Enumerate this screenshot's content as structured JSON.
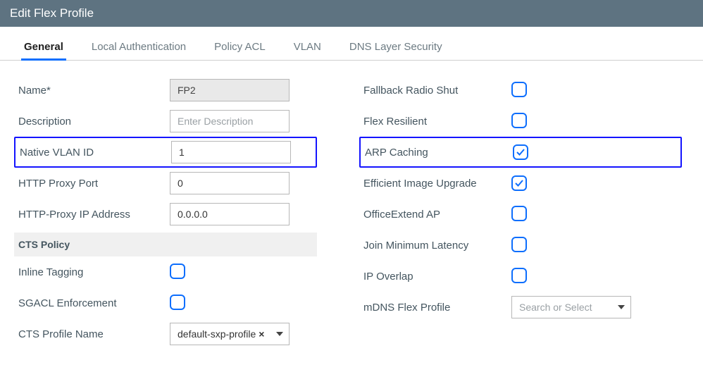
{
  "title": "Edit Flex Profile",
  "tabs": [
    {
      "label": "General",
      "active": true
    },
    {
      "label": "Local Authentication",
      "active": false
    },
    {
      "label": "Policy ACL",
      "active": false
    },
    {
      "label": "VLAN",
      "active": false
    },
    {
      "label": "DNS Layer Security",
      "active": false
    }
  ],
  "left": {
    "name_label": "Name*",
    "name_value": "FP2",
    "description_label": "Description",
    "description_placeholder": "Enter Description",
    "native_vlan_label": "Native VLAN ID",
    "native_vlan_value": "1",
    "http_proxy_port_label": "HTTP Proxy Port",
    "http_proxy_port_value": "0",
    "http_proxy_ip_label": "HTTP-Proxy IP Address",
    "http_proxy_ip_value": "0.0.0.0",
    "cts_header": "CTS Policy",
    "inline_tagging_label": "Inline Tagging",
    "sgacl_label": "SGACL Enforcement",
    "cts_profile_label": "CTS Profile Name",
    "cts_profile_value": "default-sxp-profile"
  },
  "right": {
    "fallback_label": "Fallback Radio Shut",
    "flex_resilient_label": "Flex Resilient",
    "arp_caching_label": "ARP Caching",
    "efficient_upgrade_label": "Efficient Image Upgrade",
    "officeextend_label": "OfficeExtend AP",
    "join_min_latency_label": "Join Minimum Latency",
    "ip_overlap_label": "IP Overlap",
    "mdns_label": "mDNS Flex Profile",
    "mdns_placeholder": "Search or Select"
  }
}
